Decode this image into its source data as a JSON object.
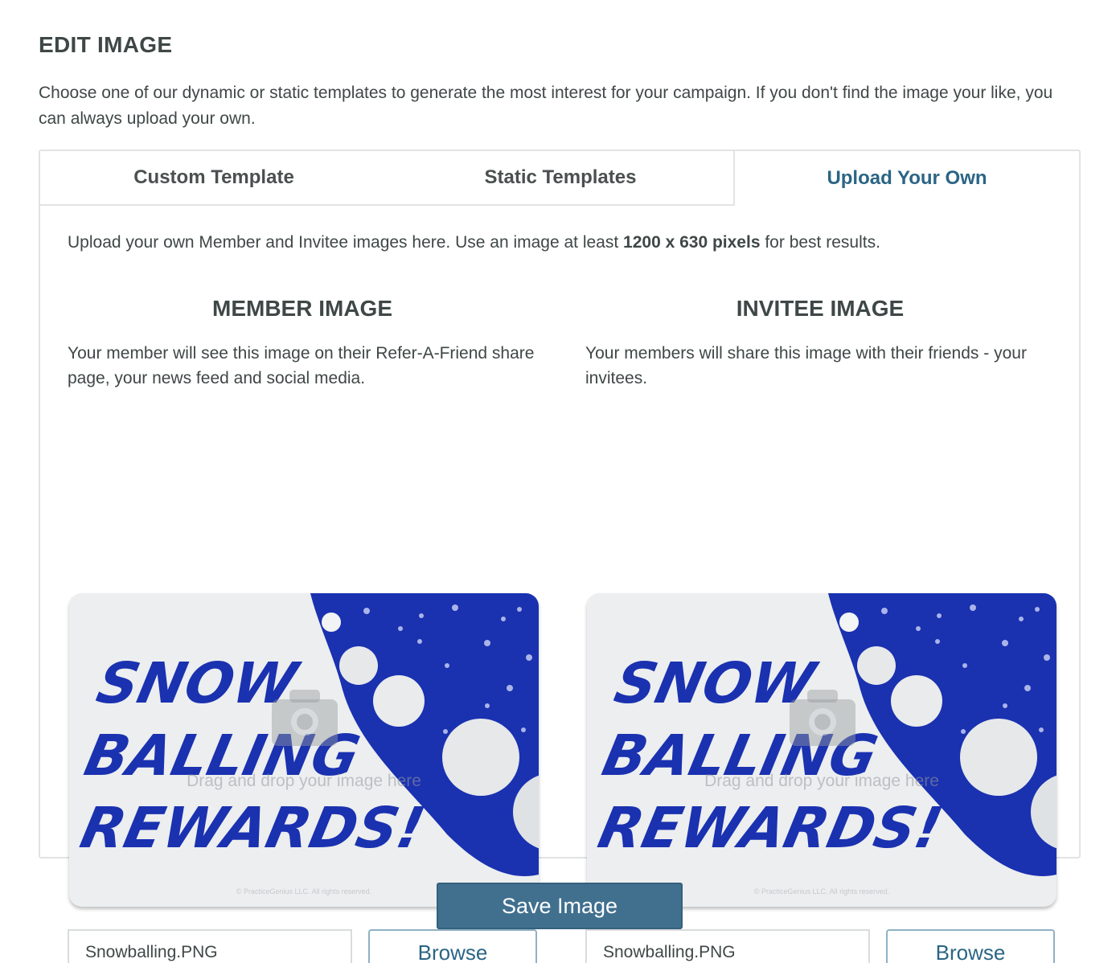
{
  "page": {
    "title": "EDIT IMAGE",
    "intro": "Choose one of our dynamic or static templates to generate the most interest for your campaign. If you don't find the image your like, you can always upload your own."
  },
  "tabs": [
    {
      "label": "Custom Template",
      "active": false
    },
    {
      "label": "Static Templates",
      "active": false
    },
    {
      "label": "Upload Your Own",
      "active": true
    }
  ],
  "upload": {
    "note_prefix": "Upload your own Member and Invitee images here. Use an image at least ",
    "note_bold": "1200 x 630 pixels",
    "note_suffix": " for best results."
  },
  "member": {
    "title": "MEMBER IMAGE",
    "description": "Your member will see this image on their Refer-A-Friend share page, your news feed and social media.",
    "image_text": [
      "SNOW",
      "BALLING",
      "REWARDS!"
    ],
    "dropzone_text": "Drag and drop your image here",
    "copyright": "© PracticeGenius LLC. All rights reserved.",
    "filename": "Snowballing.PNG",
    "browse_label": "Browse"
  },
  "invitee": {
    "title": "INVITEE IMAGE",
    "description": "Your members will share this image with their friends - your invitees.",
    "image_text": [
      "SNOW",
      "BALLING",
      "REWARDS!"
    ],
    "dropzone_text": "Drag and drop your image here",
    "copyright": "© PracticeGenius LLC. All rights reserved.",
    "filename": "Snowballing.PNG",
    "browse_label": "Browse"
  },
  "save_label": "Save Image",
  "colors": {
    "accent": "#2b6585",
    "button": "#41708f",
    "art_blue": "#1a31b0",
    "art_bg": "#eceeef"
  }
}
